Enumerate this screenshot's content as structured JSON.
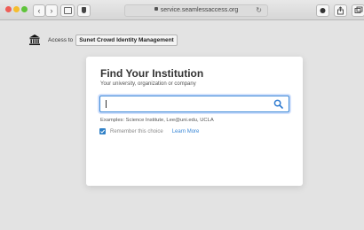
{
  "browser": {
    "url": "service.seamlessaccess.org",
    "back_glyph": "‹",
    "forward_glyph": "›",
    "reload_glyph": "↻"
  },
  "access": {
    "prefix": "Access to",
    "service_name": "Sunet Crowd Identity Management"
  },
  "card": {
    "title": "Find Your Institution",
    "subtitle": "Your university, organization or company",
    "search_value": "",
    "examples": "Examples: Science Institute, Lee@uni.edu, UCLA",
    "remember_label": "Remember this choice",
    "remember_checked": true,
    "learn_more": "Learn More"
  },
  "colors": {
    "accent": "#3a87d6",
    "page_bg": "#e3e3e3"
  }
}
